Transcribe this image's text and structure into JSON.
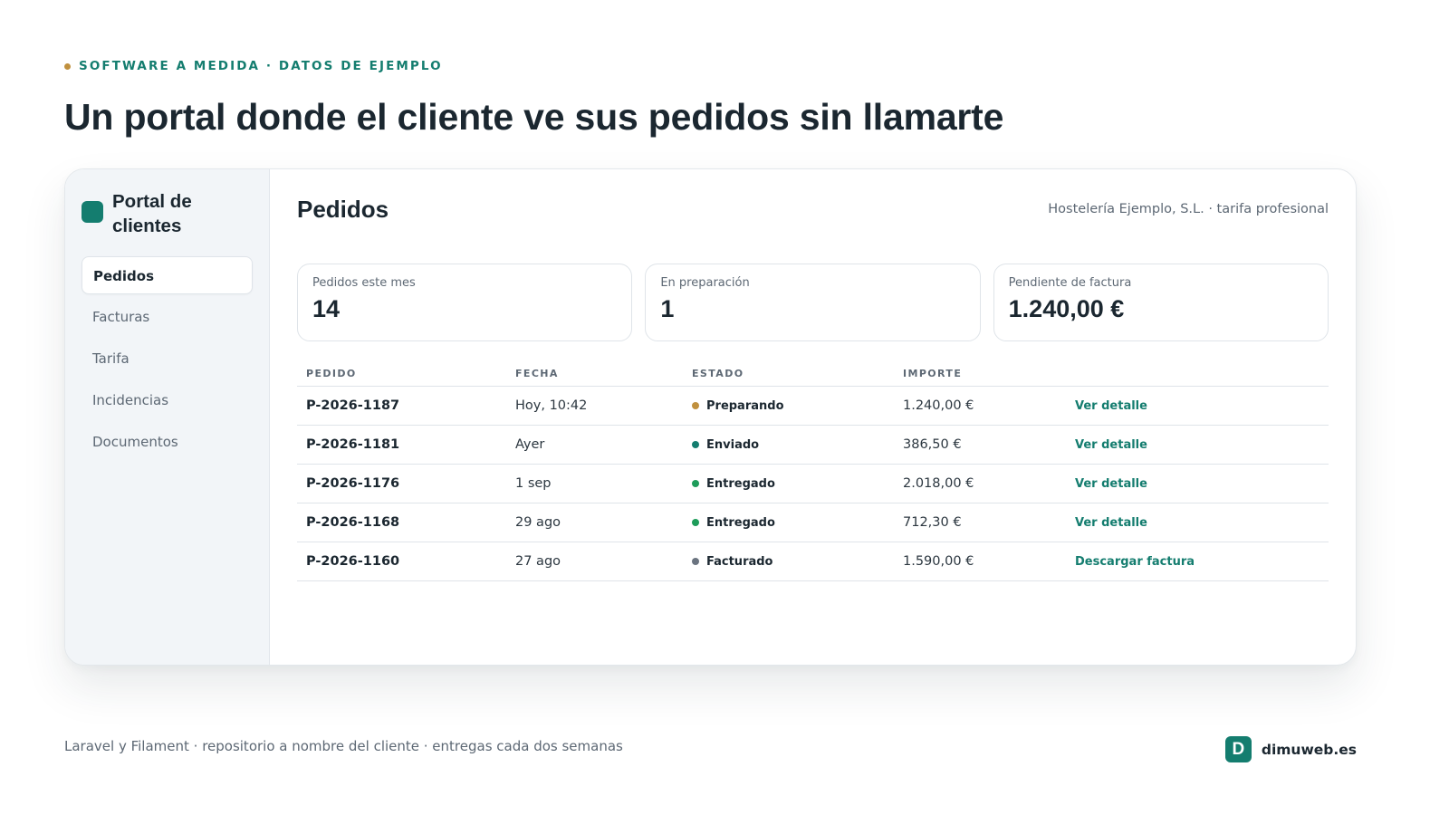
{
  "eyebrow": {
    "text": "SOFTWARE A MEDIDA · DATOS DE EJEMPLO",
    "dot_color": "#c0903e"
  },
  "headline": "Un portal donde el cliente ve sus pedidos sin llamarte",
  "sidebar": {
    "brand_name": "Portal de clientes",
    "brand_color": "#147d6f",
    "items": [
      {
        "label": "Pedidos",
        "active": true
      },
      {
        "label": "Facturas",
        "active": false
      },
      {
        "label": "Tarifa",
        "active": false
      },
      {
        "label": "Incidencias",
        "active": false
      },
      {
        "label": "Documentos",
        "active": false
      }
    ]
  },
  "main": {
    "title": "Pedidos",
    "subtitle": "Hostelería Ejemplo, S.L. · tarifa profesional",
    "stats": [
      {
        "label": "Pedidos este mes",
        "value": "14"
      },
      {
        "label": "En preparación",
        "value": "1"
      },
      {
        "label": "Pendiente de factura",
        "value": "1.240,00 €"
      }
    ],
    "table": {
      "headers": [
        "PEDIDO",
        "FECHA",
        "ESTADO",
        "IMPORTE",
        ""
      ],
      "rows": [
        {
          "id": "P-2026-1187",
          "date": "Hoy, 10:42",
          "status": "Preparando",
          "status_color": "#c0903e",
          "amount": "1.240,00 €",
          "action": "Ver detalle"
        },
        {
          "id": "P-2026-1181",
          "date": "Ayer",
          "status": "Enviado",
          "status_color": "#147d6f",
          "amount": "386,50 €",
          "action": "Ver detalle"
        },
        {
          "id": "P-2026-1176",
          "date": "1 sep",
          "status": "Entregado",
          "status_color": "#1e9c5a",
          "amount": "2.018,00 €",
          "action": "Ver detalle"
        },
        {
          "id": "P-2026-1168",
          "date": "29 ago",
          "status": "Entregado",
          "status_color": "#1e9c5a",
          "amount": "712,30 €",
          "action": "Ver detalle"
        },
        {
          "id": "P-2026-1160",
          "date": "27 ago",
          "status": "Facturado",
          "status_color": "#6b7480",
          "amount": "1.590,00 €",
          "action": "Descargar factura"
        }
      ]
    }
  },
  "footer": {
    "note": "Laravel y Filament · repositorio a nombre del cliente · entregas cada dos semanas",
    "logo_letter": "D",
    "domain": "dimuweb.es"
  }
}
